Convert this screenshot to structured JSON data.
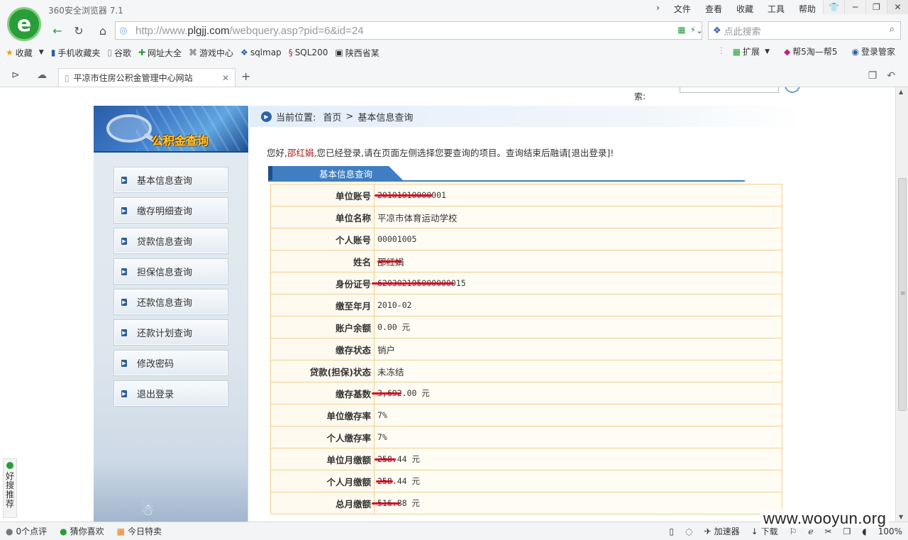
{
  "browser": {
    "app_title": "360安全浏览器 7.1",
    "menu": [
      "文件",
      "查看",
      "收藏",
      "工具",
      "帮助"
    ],
    "url_prefix": "http://www.",
    "url_domain": "plgjj.com",
    "url_path": "/webquery.asp?pid=6&id=24",
    "search_placeholder": "点此搜索",
    "bookmarks": [
      {
        "label": "收藏",
        "icon": "star-icon"
      },
      {
        "label": "手机收藏夹",
        "icon": "phone-icon"
      },
      {
        "label": "谷歌",
        "icon": "page-icon"
      },
      {
        "label": "网址大全",
        "icon": "site-icon"
      },
      {
        "label": "游戏中心",
        "icon": "gamepad-icon"
      },
      {
        "label": "sqlmap",
        "icon": "paw-icon"
      },
      {
        "label": "SQL200",
        "icon": "sql-icon"
      },
      {
        "label": "陕西省某",
        "icon": "monitor-icon"
      }
    ],
    "bookmarks_right": [
      "扩展",
      "帮5淘—帮5",
      "登录管家"
    ],
    "tab_title": "平凉市住房公积金管理中心网站"
  },
  "page": {
    "top_search_label": "索:",
    "banner_text": "公积金查询",
    "side_menu": [
      "基本信息查询",
      "缴存明细查询",
      "贷款信息查询",
      "担保信息查询",
      "还款信息查询",
      "还款计划查询",
      "修改密码",
      "退出登录"
    ],
    "breadcrumb": {
      "label": "当前位置:",
      "home": "首页",
      "sep": ">",
      "current": "基本信息查询"
    },
    "welcome": {
      "pre": "您好,",
      "name": "邵红娟",
      "post": ",您已经登录,请在页面左侧选择您要查询的项目。查询结束后融请[退出登录]!"
    },
    "section_title": "基本信息查询",
    "rows": [
      {
        "k": "单位账号",
        "v": "20101010000001"
      },
      {
        "k": "单位名称",
        "v": "平凉市体育运动学校"
      },
      {
        "k": "个人账号",
        "v": "00001005"
      },
      {
        "k": "姓名",
        "v": "邵红娟"
      },
      {
        "k": "身份证号",
        "v": "620302195000000015"
      },
      {
        "k": "缴至年月",
        "v": "2010-02"
      },
      {
        "k": "账户余额",
        "v": "0.00 元"
      },
      {
        "k": "缴存状态",
        "v": "销户"
      },
      {
        "k": "贷款(担保)状态",
        "v": "未冻结"
      },
      {
        "k": "缴存基数",
        "v": "3,692.00 元"
      },
      {
        "k": "单位缴存率",
        "v": "7%"
      },
      {
        "k": "个人缴存率",
        "v": "7%"
      },
      {
        "k": "单位月缴额",
        "v": "258.44 元"
      },
      {
        "k": "个人月缴额",
        "v": "258.44 元"
      },
      {
        "k": "总月缴额",
        "v": "516.88 元"
      }
    ]
  },
  "float_panel": "好搜推荐",
  "status": {
    "left": [
      "0个点评",
      "猜你喜欢",
      "今日特卖"
    ],
    "right": [
      "加速器",
      "下载"
    ],
    "zoom": "100%"
  },
  "watermark": "www.wooyun.org"
}
